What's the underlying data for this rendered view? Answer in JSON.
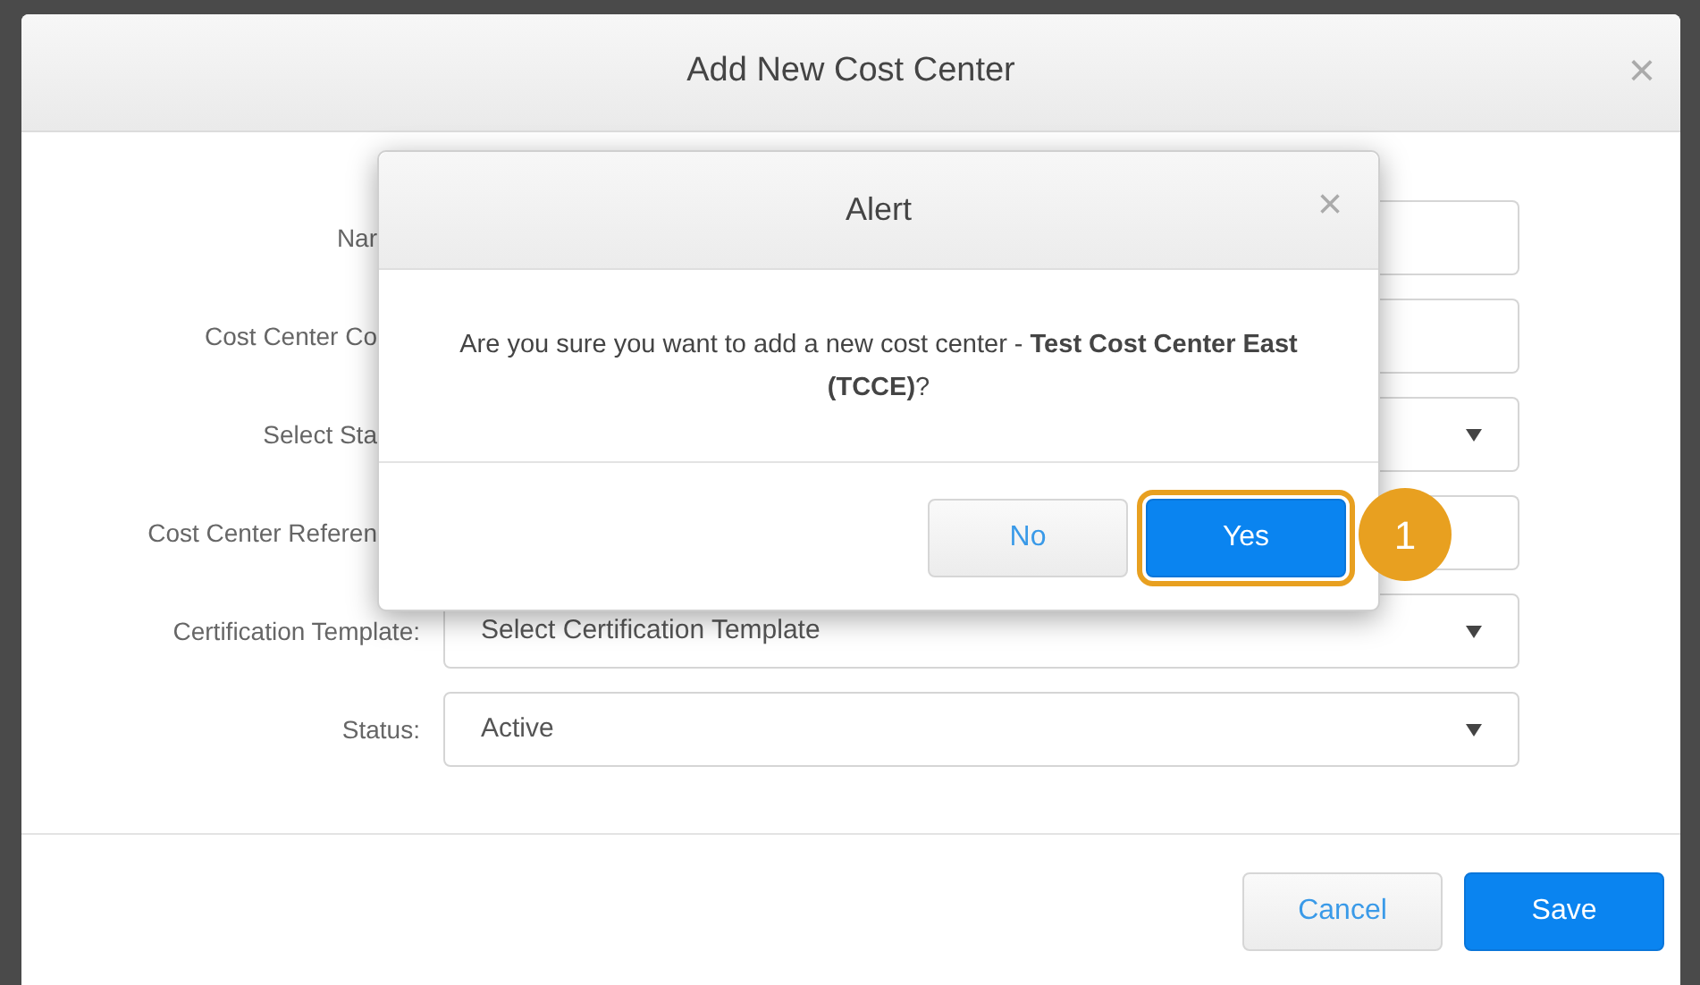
{
  "dialog": {
    "title": "Add New Cost Center",
    "close": "×"
  },
  "form": [
    {
      "label": "Nar",
      "covered": true,
      "kind": "input"
    },
    {
      "label": "Cost Center Co",
      "covered": true,
      "kind": "input"
    },
    {
      "label": "Select Sta",
      "covered": true,
      "kind": "select"
    },
    {
      "label": "Cost Center Referen",
      "covered": true,
      "kind": "input"
    },
    {
      "label": "Certification Template:",
      "covered": false,
      "kind": "select",
      "value": "Select Certification Template"
    },
    {
      "label": "Status:",
      "covered": false,
      "kind": "select",
      "value": "Active"
    }
  ],
  "buttons": [
    {
      "label": "Cancel",
      "kind": "secondary"
    },
    {
      "label": "Save",
      "kind": "primary"
    }
  ],
  "alert": {
    "title": "Alert",
    "close": "×",
    "message": "Are you sure you want to add a new cost center - **Test Cost Center East (TCCE)**?",
    "buttons": [
      {
        "label": "No",
        "kind": "secondary",
        "highlighted": false
      },
      {
        "label": "Yes",
        "kind": "primary",
        "highlighted": true
      }
    ]
  },
  "step_badge": "1"
}
